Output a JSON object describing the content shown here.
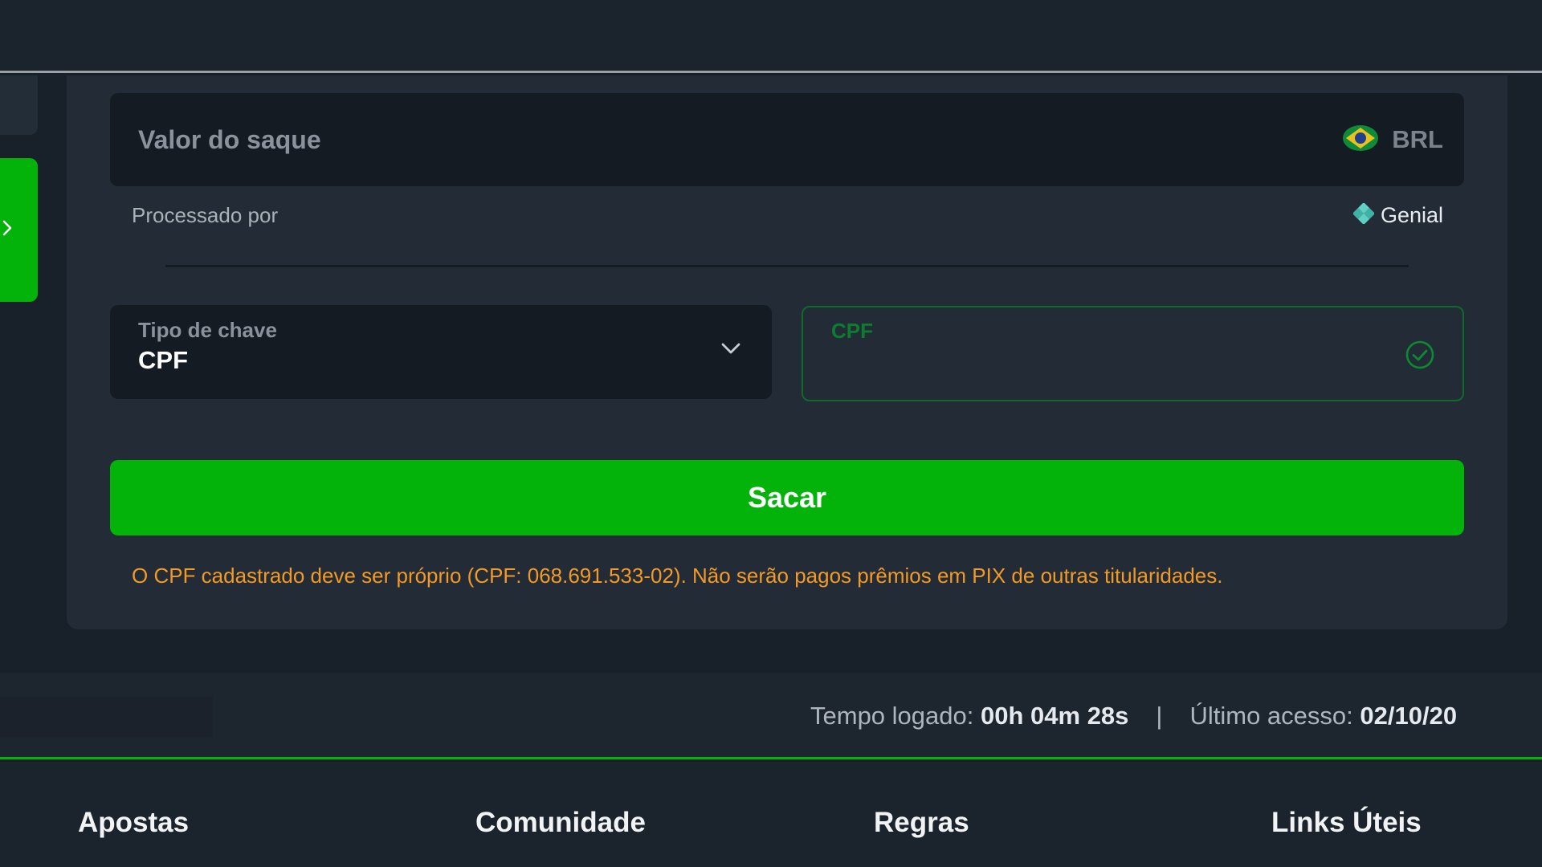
{
  "withdraw": {
    "amount_label": "Valor do saque",
    "currency": "BRL",
    "processed_label": "Processado por",
    "provider": "Genial",
    "key_type_label": "Tipo de chave",
    "key_type_value": "CPF",
    "cpf_label": "CPF",
    "cpf_value": "",
    "submit_label": "Sacar",
    "notice": "O CPF cadastrado deve ser próprio (CPF: 068.691.533-02). Não serão pagos prêmios em PIX de outras titularidades."
  },
  "status": {
    "time_label": "Tempo logado:",
    "time_value": "00h 04m 28s",
    "separator": "|",
    "last_access_label": "Último acesso:",
    "last_access_value": "02/10/20"
  },
  "footer": {
    "columns": [
      "Apostas",
      "Comunidade",
      "Regras",
      "Links Úteis"
    ]
  },
  "colors": {
    "accent_green": "#03b30a",
    "notice_orange": "#f29a24",
    "provider_teal": "#4fc3b8"
  }
}
